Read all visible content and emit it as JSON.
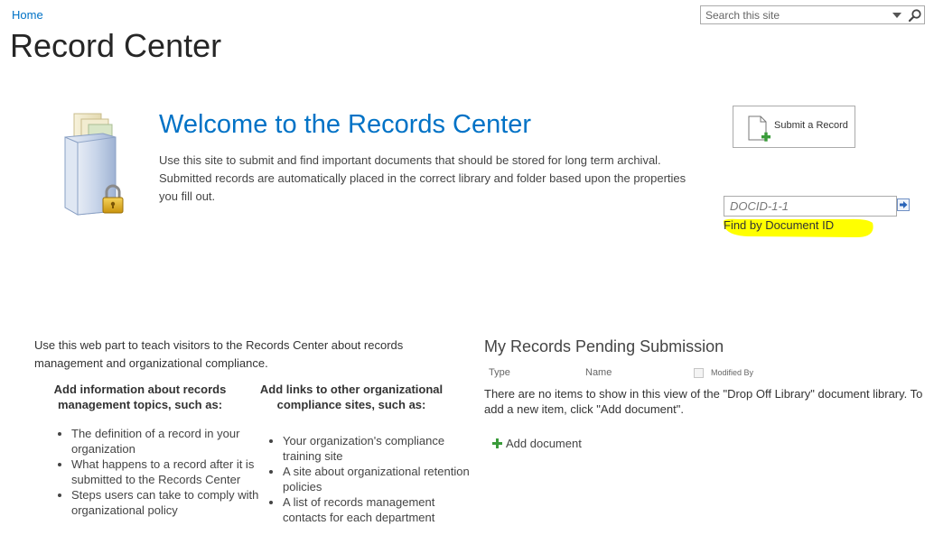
{
  "breadcrumb": {
    "home_label": "Home"
  },
  "site": {
    "title": "Record Center"
  },
  "search": {
    "placeholder": "Search this site"
  },
  "welcome": {
    "title": "Welcome to the Records Center",
    "description": "Use this site to submit and find important documents that should be stored for long term archival. Submitted records are automatically placed in the correct library and folder based upon the properties you fill out."
  },
  "submit_record": {
    "label": "Submit a Record"
  },
  "find_by_id": {
    "placeholder": "DOCID-1-1",
    "label": "Find by Document ID",
    "highlight_color": "#ffff00"
  },
  "teach": {
    "intro": "Use this web part to teach visitors to the Records Center about records management and organizational compliance.",
    "columns": [
      {
        "heading": "Add information about records management topics, such as:",
        "items": [
          "The definition of a record in your organization",
          "What happens to a record after it is submitted to the Records Center",
          "Steps users can take to comply with organizational policy"
        ]
      },
      {
        "heading": "Add links to other organizational compliance sites, such as:",
        "items": [
          "Your organization's compliance training site",
          "A site about organizational retention policies",
          "A list of records management contacts for each department"
        ]
      }
    ]
  },
  "pending": {
    "title": "My Records Pending Submission",
    "columns": {
      "type": "Type",
      "name": "Name",
      "modified_by": "Modified By"
    },
    "empty_message": "There are no items to show in this view of the \"Drop Off Library\" document library. To add a new item, click \"Add document\".",
    "add_label": "Add document"
  },
  "colors": {
    "link": "#0072c6",
    "title": "#262626",
    "add_icon": "#3a9b3a"
  }
}
